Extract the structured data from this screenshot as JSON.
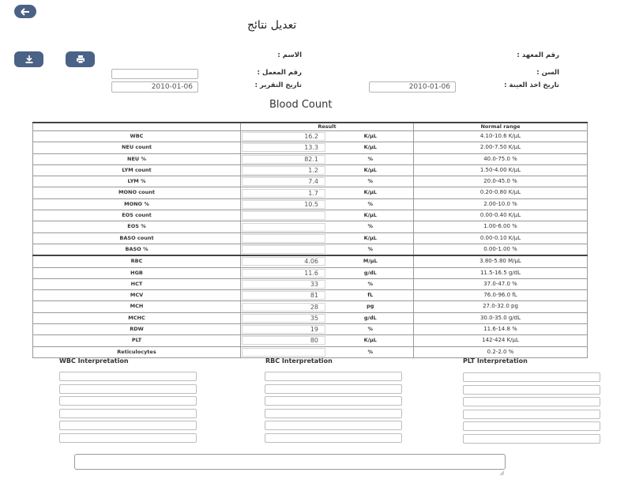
{
  "header": {
    "title": "تعديل نتائج",
    "back_icon": "arrow-left-icon",
    "download_icon": "download-icon",
    "print_icon": "printer-icon"
  },
  "form": {
    "institute_no_label": "رقم المعهد :",
    "name_label": "الاسم :",
    "age_label": "السن :",
    "lab_no_label": "رقم المعمل :",
    "lab_no_value": "",
    "sample_date_label": "تاريخ اخذ العينة :",
    "sample_date_value": "2010-01-06",
    "report_date_label": "تاريخ التقرير :",
    "report_date_value": "2010-01-06"
  },
  "section_title": "Blood Count",
  "table": {
    "headers": {
      "param": "",
      "result": "Result",
      "normal_range": "Normal range"
    },
    "rows": [
      {
        "param": "WBC",
        "value": "16.2",
        "unit": "K/µL",
        "range": "4.10-10.6 K/µL"
      },
      {
        "param": "NEU count",
        "value": "13.3",
        "unit": "K/µL",
        "range": "2.00-7.50 K/µL"
      },
      {
        "param": "NEU %",
        "value": "82.1",
        "unit": "%",
        "range": "40.0-75.0 %"
      },
      {
        "param": "LYM count",
        "value": "1.2",
        "unit": "K/µL",
        "range": "1.50-4.00 K/µL"
      },
      {
        "param": "LYM %",
        "value": "7.4",
        "unit": "%",
        "range": "20.0-45.0 %"
      },
      {
        "param": "MONO count",
        "value": "1.7",
        "unit": "K/µL",
        "range": "0.20-0.80 K/µL"
      },
      {
        "param": "MONO %",
        "value": "10.5",
        "unit": "%",
        "range": "2.00-10.0 %"
      },
      {
        "param": "EOS count",
        "value": "",
        "unit": "K/µL",
        "range": "0.00-0.40 K/µL"
      },
      {
        "param": "EOS %",
        "value": "",
        "unit": "%",
        "range": "1.00-6.00 %"
      },
      {
        "param": "BASO count",
        "value": "",
        "unit": "K/µL",
        "range": "0.00-0.10 K/µL"
      },
      {
        "param": "BASO %",
        "value": "",
        "unit": "%",
        "range": "0.00-1.00 %"
      },
      {
        "param": "RBC",
        "value": "4.06",
        "unit": "M/µL",
        "range": "3.80-5.80 M/µL"
      },
      {
        "param": "HGB",
        "value": "11.6",
        "unit": "g/dL",
        "range": "11.5-16.5 g/dL"
      },
      {
        "param": "HCT",
        "value": "33",
        "unit": "%",
        "range": "37.0-47.0 %"
      },
      {
        "param": "MCV",
        "value": "81",
        "unit": "fL",
        "range": "76.0-96.0 fL"
      },
      {
        "param": "MCH",
        "value": "28",
        "unit": "pg",
        "range": "27.0-32.0 pg"
      },
      {
        "param": "MCHC",
        "value": "35",
        "unit": "g/dL",
        "range": "30.0-35.0 g/dL"
      },
      {
        "param": "RDW",
        "value": "19",
        "unit": "%",
        "range": "11.6-14.8 %"
      },
      {
        "param": "PLT",
        "value": "80",
        "unit": "K/µL",
        "range": "142-424 K/µL"
      },
      {
        "param": "Reticulocytes",
        "value": "",
        "unit": "%",
        "range": "0.2-2.0 %"
      }
    ]
  },
  "interpretation": {
    "wbc_title": "WBC Interpretation",
    "rbc_title": "RBC Interpretation",
    "plt_title": "PLT Interpretation"
  },
  "colors": {
    "button": "#4a6285",
    "border": "#444444"
  }
}
